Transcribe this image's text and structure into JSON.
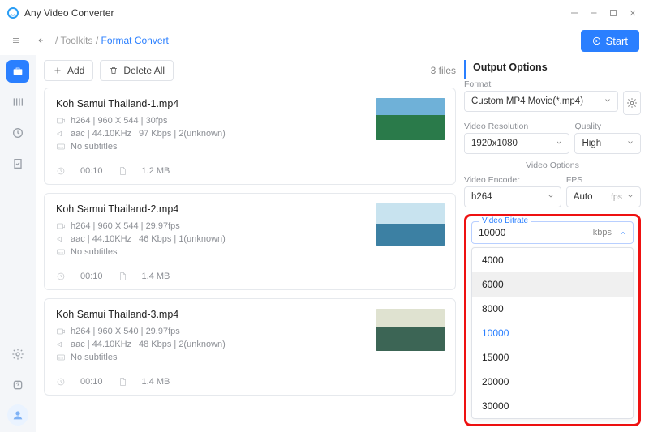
{
  "app": {
    "title": "Any Video Converter"
  },
  "crumbs": {
    "root": "Toolkits",
    "page": "Format Convert"
  },
  "start_label": "Start",
  "toolbar": {
    "add_label": "Add",
    "deleteall_label": "Delete All"
  },
  "filecount": "3 files",
  "files": [
    {
      "name": "Koh Samui Thailand-1.mp4",
      "video": "h264 | 960 X 544 | 30fps",
      "audio": "aac | 44.10KHz | 97 Kbps | 2(unknown)",
      "subs": "No subtitles",
      "duration": "00:10",
      "size": "1.2 MB"
    },
    {
      "name": "Koh Samui Thailand-2.mp4",
      "video": "h264 | 960 X 544 | 29.97fps",
      "audio": "aac | 44.10KHz | 46 Kbps | 1(unknown)",
      "subs": "No subtitles",
      "duration": "00:10",
      "size": "1.4 MB"
    },
    {
      "name": "Koh Samui Thailand-3.mp4",
      "video": "h264 | 960 X 540 | 29.97fps",
      "audio": "aac | 44.10KHz | 48 Kbps | 2(unknown)",
      "subs": "No subtitles",
      "duration": "00:10",
      "size": "1.4 MB"
    }
  ],
  "output": {
    "title": "Output Options",
    "format_label": "Format",
    "format_value": "Custom MP4 Movie(*.mp4)",
    "res_label": "Video Resolution",
    "res_value": "1920x1080",
    "quality_label": "Quality",
    "quality_value": "High",
    "video_options_label": "Video Options",
    "encoder_label": "Video Encoder",
    "encoder_value": "h264",
    "fps_label": "FPS",
    "fps_value": "Auto",
    "fps_unit": "fps",
    "bitrate_label": "Video Bitrate",
    "bitrate_value": "10000",
    "bitrate_unit": "kbps",
    "bitrate_options": [
      "4000",
      "6000",
      "8000",
      "10000",
      "15000",
      "20000",
      "30000"
    ],
    "bitrate_hover": "6000",
    "bitrate_selected": "10000"
  }
}
